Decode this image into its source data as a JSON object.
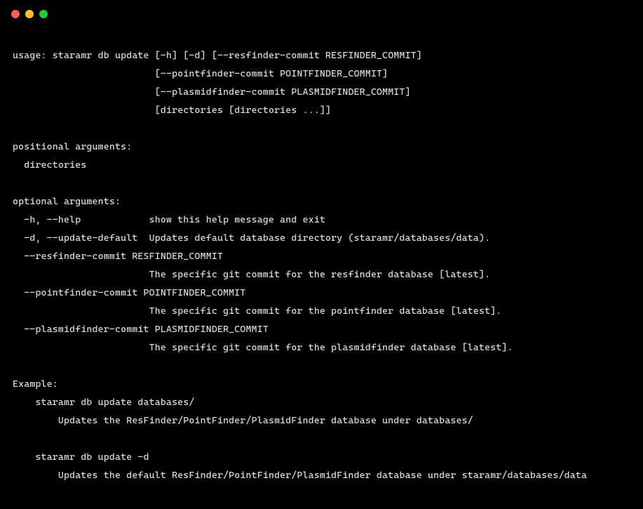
{
  "help": {
    "usage": [
      "usage: staramr db update [-h] [-d] [--resfinder-commit RESFINDER_COMMIT]",
      "                         [--pointfinder-commit POINTFINDER_COMMIT]",
      "                         [--plasmidfinder-commit PLASMIDFINDER_COMMIT]",
      "                         [directories [directories ...]]"
    ],
    "positional_header": "positional arguments:",
    "positional": [
      "  directories"
    ],
    "optional_header": "optional arguments:",
    "optional": [
      "  -h, --help            show this help message and exit",
      "  -d, --update-default  Updates default database directory (staramr/databases/data).",
      "  --resfinder-commit RESFINDER_COMMIT",
      "                        The specific git commit for the resfinder database [latest].",
      "  --pointfinder-commit POINTFINDER_COMMIT",
      "                        The specific git commit for the pointfinder database [latest].",
      "  --plasmidfinder-commit PLASMIDFINDER_COMMIT",
      "                        The specific git commit for the plasmidfinder database [latest]."
    ],
    "example_header": "Example:",
    "example": [
      "    staramr db update databases/",
      "        Updates the ResFinder/PointFinder/PlasmidFinder database under databases/",
      "",
      "    staramr db update -d",
      "        Updates the default ResFinder/PointFinder/PlasmidFinder database under staramr/databases/data"
    ]
  }
}
